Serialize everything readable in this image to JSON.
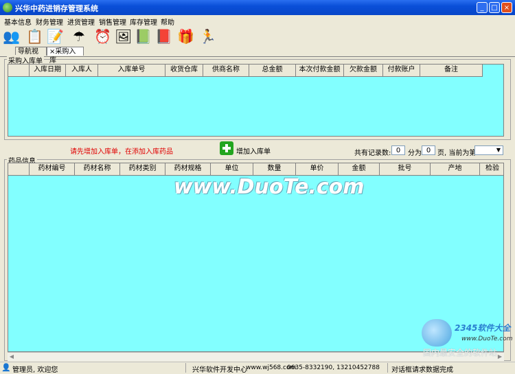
{
  "window": {
    "title": "兴华中药进销存管理系统",
    "minimize": "_",
    "maximize": "□",
    "close": "×"
  },
  "menu": [
    "基本信息",
    "财务管理",
    "进货管理",
    "销售管理",
    "库存管理",
    "帮助"
  ],
  "toolbar_icons": [
    {
      "name": "users-icon",
      "glyph": "👥"
    },
    {
      "name": "documents-icon",
      "glyph": "📋"
    },
    {
      "name": "edit-document-icon",
      "glyph": "📝"
    },
    {
      "name": "umbrella-icon",
      "glyph": "☂"
    },
    {
      "name": "alarm-clock-icon",
      "glyph": "⏰"
    },
    {
      "name": "picture-icon",
      "glyph": "🖼"
    },
    {
      "name": "notebook-icon",
      "glyph": "📗"
    },
    {
      "name": "help-book-icon",
      "glyph": "📕"
    },
    {
      "name": "gift-icon",
      "glyph": "🎁"
    },
    {
      "name": "exit-runner-icon",
      "glyph": "🏃"
    }
  ],
  "tabs": {
    "nav": "导航视图",
    "purchase": "×采购入库"
  },
  "order_group": {
    "title": "采购入库单",
    "columns": [
      "入库日期",
      "入库人",
      "入库单号",
      "收货仓库",
      "供商名称",
      "总金额",
      "本次付款金额",
      "欠款金额",
      "付款账户",
      "备注"
    ]
  },
  "actions": {
    "hint": "请先增加入库单，在添加入库药品",
    "add_order": "增加入库单"
  },
  "pager": {
    "total_label": "共有记录数:",
    "total": "0",
    "split_label": "分为",
    "pages": "0",
    "current_label": "页, 当前为第",
    "current": ""
  },
  "drug_group": {
    "title": "药品信息",
    "columns": [
      "药材编号",
      "药材名称",
      "药材类别",
      "药材规格",
      "单位",
      "数量",
      "单价",
      "金额",
      "批号",
      "产地",
      "检验"
    ]
  },
  "status": {
    "user": "管理员, 欢迎您",
    "company": "兴华软件开发中心",
    "site": "www.wj568.com",
    "phone": "0635-8332190, 13210452788",
    "message": "对话框请求数据完成"
  },
  "watermarks": {
    "duote": "www.DuoTe.com",
    "brand": "2345软件大全",
    "brand_url": "www.DuoTe.com",
    "slogan": "国内最安全的软件站"
  },
  "colors": {
    "grid_bg": "#82FFFF",
    "title_bar": "#0A4FD8",
    "hint": "#E00000",
    "add_icon": "#23A51F"
  }
}
